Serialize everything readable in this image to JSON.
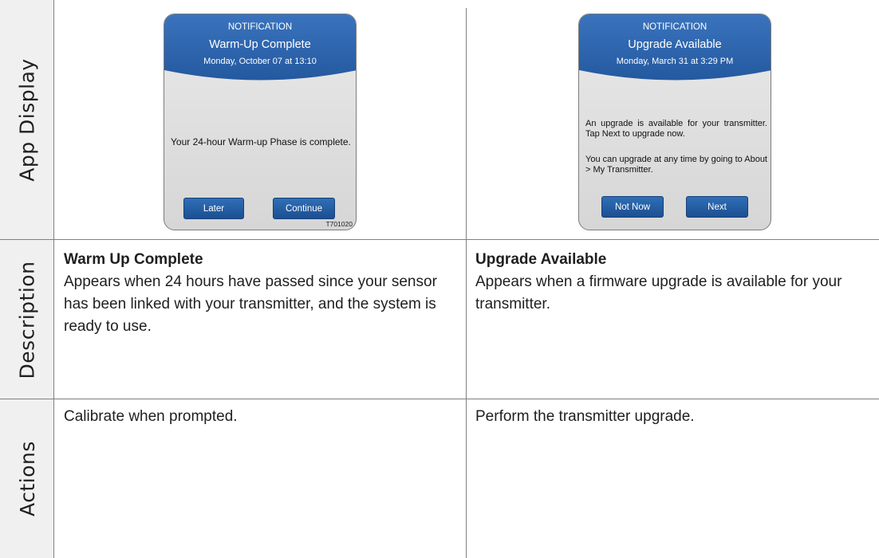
{
  "rows": {
    "app_display": "App Display",
    "description": "Description",
    "actions": "Actions"
  },
  "left": {
    "screen": {
      "kicker": "NOTIFICATION",
      "title": "Warm-Up Complete",
      "date": "Monday, October 07 at 13:10",
      "body": "Your 24-hour Warm-up Phase is complete.",
      "button_secondary": "Later",
      "button_primary": "Continue",
      "code": "T701020"
    },
    "description_title": "Warm Up Complete",
    "description_text": "Appears when 24 hours have passed since your sensor has been linked with your transmitter, and the system is ready to use.",
    "action_text": "Calibrate when prompted."
  },
  "right": {
    "screen": {
      "kicker": "NOTIFICATION",
      "title": "Upgrade Available",
      "date": "Monday, March 31 at 3:29 PM",
      "body_1": "An upgrade is available for your transmitter. Tap Next to upgrade now.",
      "body_2": "You can upgrade at any time by going to About > My Transmitter.",
      "button_secondary": "Not Now",
      "button_primary": "Next"
    },
    "description_title": "Upgrade Available",
    "description_text": "Appears when a firmware upgrade is available for your transmitter.",
    "action_text": "Perform the transmitter upgrade."
  },
  "colors": {
    "header_blue": "#2b63ad",
    "button_blue": "#1f5598",
    "sidebar_gray": "#f0f0f0",
    "grid_line": "#808080"
  }
}
